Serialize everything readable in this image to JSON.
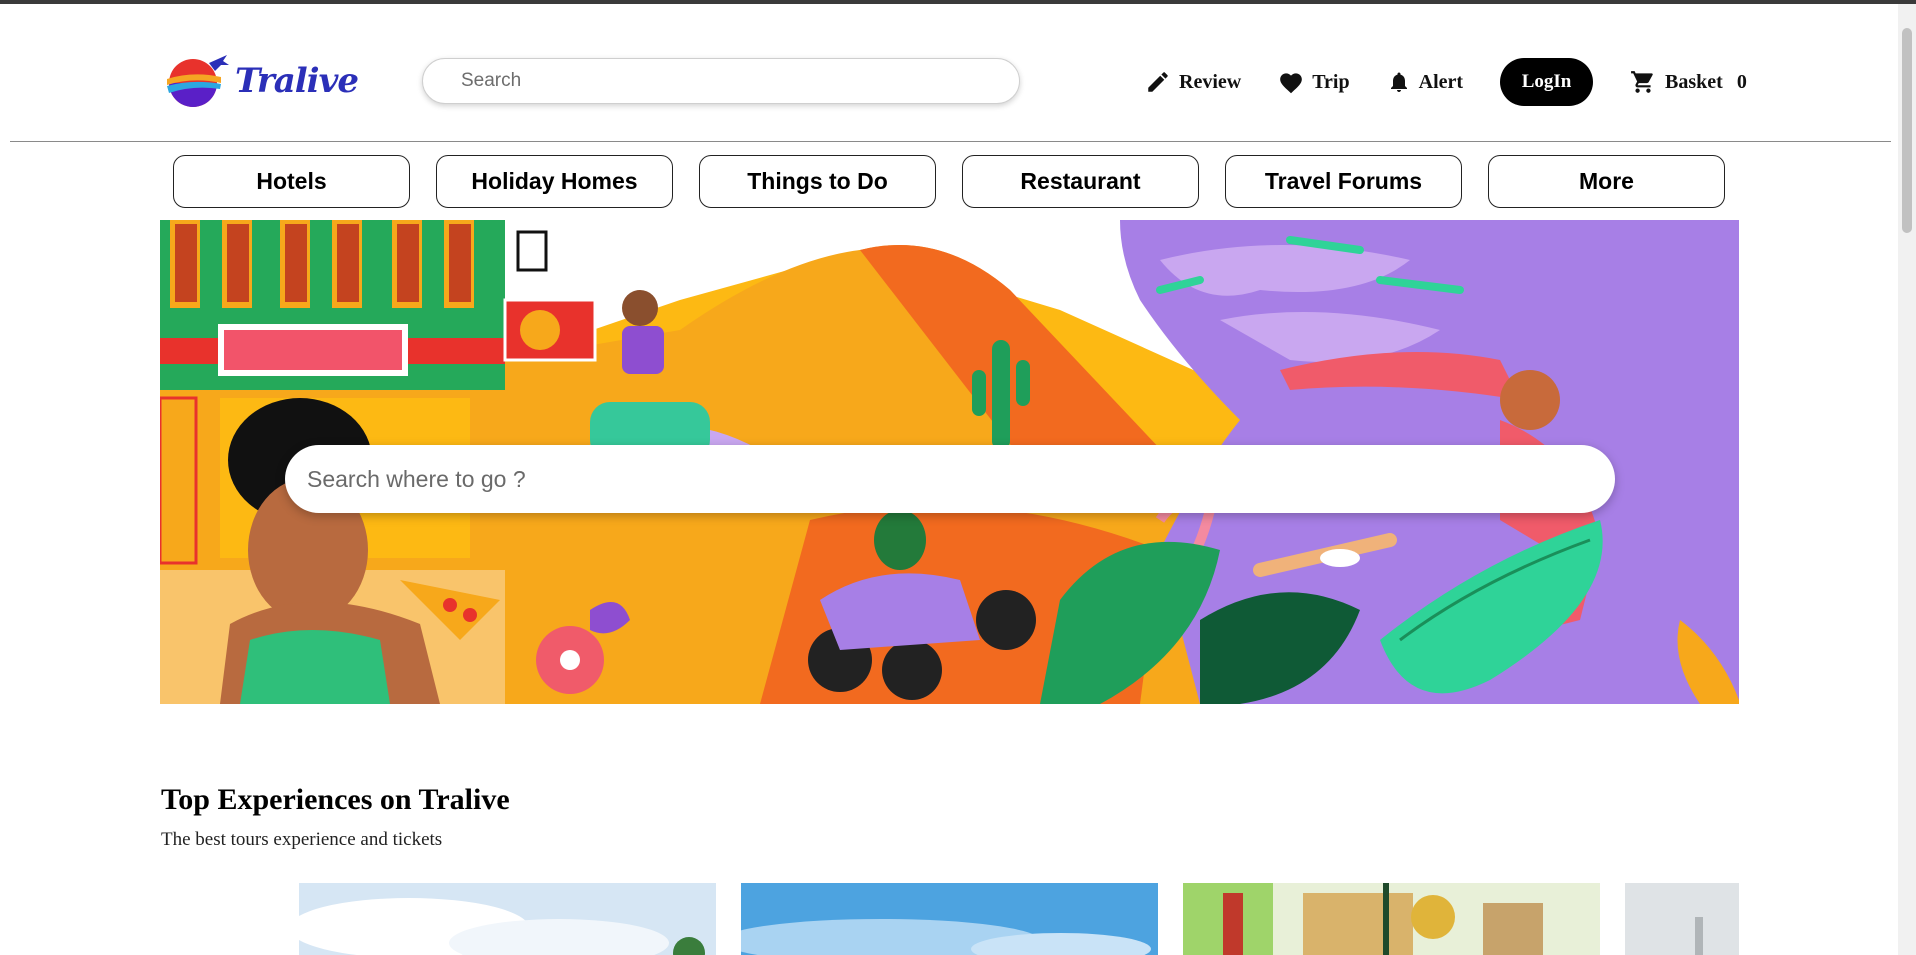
{
  "header": {
    "logo_text": "Tralive",
    "search_placeholder": "Search",
    "actions": {
      "review_label": "Review",
      "trip_label": "Trip",
      "alert_label": "Alert",
      "login_label": "LogIn",
      "basket_label": "Basket",
      "basket_count": "0"
    }
  },
  "nav": {
    "items": [
      {
        "label": "Hotels"
      },
      {
        "label": "Holiday Homes"
      },
      {
        "label": "Things to Do"
      },
      {
        "label": "Restaurant"
      },
      {
        "label": "Travel Forums"
      },
      {
        "label": "More"
      }
    ]
  },
  "hero": {
    "search_placeholder": "Search where to go ?"
  },
  "experiences": {
    "title": "Top Experiences on Tralive",
    "subtitle": "The best tours experience and tickets"
  },
  "colors": {
    "brand_blue": "#2b2fb8",
    "accent_orange": "#f7a81b",
    "accent_purple": "#a77fe6"
  }
}
